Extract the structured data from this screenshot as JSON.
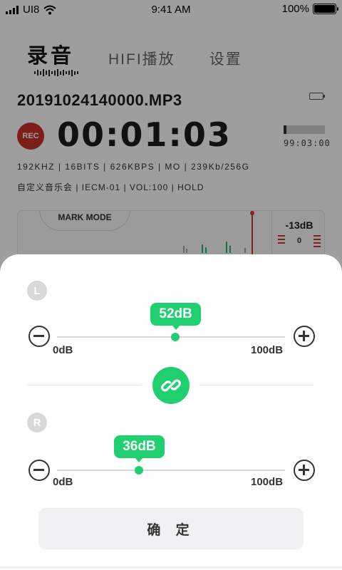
{
  "status": {
    "carrier": "UI8",
    "time": "9:41 AM",
    "battery": "100%"
  },
  "tabs": [
    {
      "label": "录音"
    },
    {
      "label": "HIFI播放"
    },
    {
      "label": "设置"
    }
  ],
  "recorder": {
    "filename": "20191024140000.MP3",
    "rec_label": "REC",
    "elapsed": "00:01:03",
    "remaining": "99:03:00",
    "specs_line1": "192KHZ | 16BITS | 626KBPS | MO | 239Kb/256G",
    "specs_line2": "自定义音乐会 | IECM-01 | VOL:100 | HOLD",
    "mark_mode": "MARK MODE",
    "level_db": "-13dB",
    "level_zero": "0"
  },
  "gain": {
    "left": {
      "channel": "L",
      "value": "52dB",
      "level": 52,
      "min": "0dB",
      "max": "100dB"
    },
    "right": {
      "channel": "R",
      "value": "36dB",
      "level": 36,
      "min": "0dB",
      "max": "100dB"
    },
    "confirm_label": "确 定"
  },
  "colors": {
    "accent": "#20cf6f",
    "rec": "#c8332a"
  },
  "icons": [
    "signal-icon",
    "wifi-icon",
    "battery-icon",
    "minus-icon",
    "plus-icon",
    "link-icon"
  ]
}
